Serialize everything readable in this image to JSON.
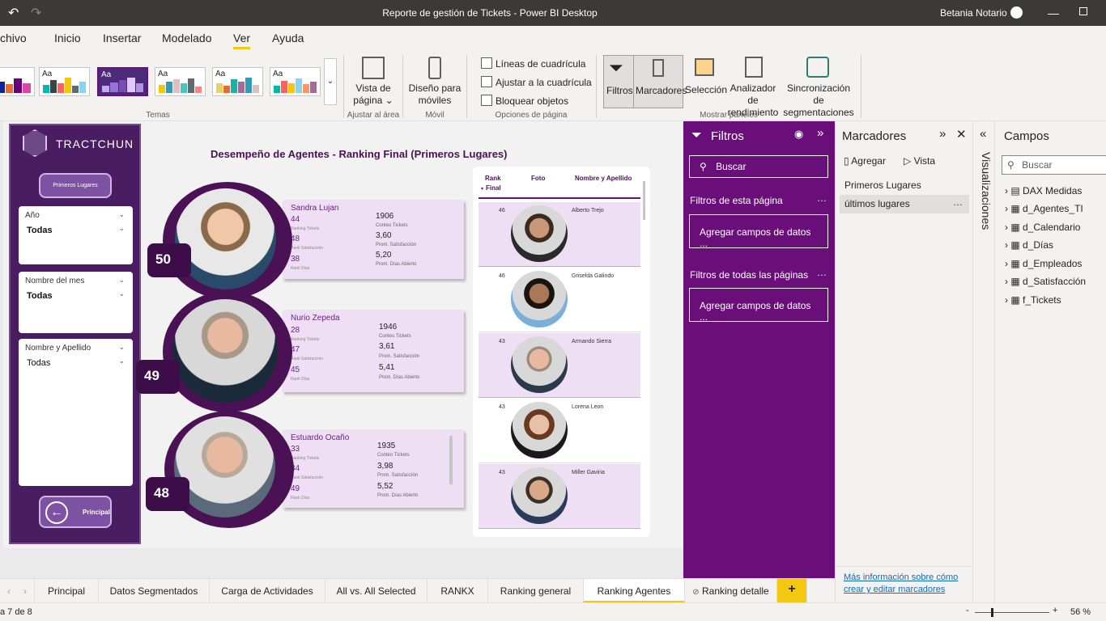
{
  "window": {
    "title": "Reporte de gestión de Tickets - Power BI Desktop",
    "user": "Betania Notario"
  },
  "menu": [
    "chivo",
    "Inicio",
    "Insertar",
    "Modelado",
    "Ver",
    "Ayuda"
  ],
  "ribbon": {
    "theme_aa": "Aa",
    "temas_label": "Temas",
    "vista_pagina": "Vista de",
    "vista_pagina2": "página",
    "ajustar_area": "Ajustar al área",
    "diseno_moviles": "Diseño para",
    "diseno_moviles2": "móviles",
    "movil": "Móvil",
    "lineas": "Líneas de cuadrícula",
    "ajustar": "Ajustar a la cuadrícula",
    "bloquear": "Bloquear objetos",
    "opciones": "Opciones de página",
    "filtros": "Filtros",
    "marcadores": "Marcadores",
    "seleccion": "Selección",
    "analizador": "Analizador de",
    "analizador2": "rendimiento",
    "sincronizacion": "Sincronización de",
    "sincronizacion2": "segmentaciones",
    "mostrar": "Mostrar paneles"
  },
  "report": {
    "brand": "TRACTCHUN",
    "btn_primeros": "Primeros Lugares",
    "btn_principal": "Principal",
    "title": "Desempeño de Agentes - Ranking Final (Primeros Lugares)",
    "slicers": [
      {
        "label": "Año",
        "value": "Todas"
      },
      {
        "label": "Nombre del mes",
        "value": "Todas"
      },
      {
        "label": "Nombre y Apellido",
        "value": "Todas"
      }
    ],
    "agents": [
      {
        "rank": "50",
        "name": "Sandra Lujan",
        "rt": "44",
        "rt_l": "Ranking Tickets",
        "rs": "48",
        "rs_l": "Rank Satisfacción",
        "rd": "38",
        "rd_l": "Rank Días",
        "ct": "1906",
        "ct_l": "Conteo Tickets",
        "ps": "3,60",
        "ps_l": "Prom. Satisfacción",
        "pd": "5,20",
        "pd_l": "Prom. Días Abierto"
      },
      {
        "rank": "49",
        "name": "Nurio Zepeda",
        "rt": "28",
        "rt_l": "Ranking Tickets",
        "rs": "47",
        "rs_l": "Rank Satisfacción",
        "rd": "45",
        "rd_l": "Rank Días",
        "ct": "1946",
        "ct_l": "Conteo Tickets",
        "ps": "3,61",
        "ps_l": "Prom. Satisfacción",
        "pd": "5,41",
        "pd_l": "Prom. Días Abierto"
      },
      {
        "rank": "48",
        "name": "Estuardo Ocaño",
        "rt": "33",
        "rt_l": "Ranking Tickets",
        "rs": "34",
        "rs_l": "Rank Satisfacción",
        "rd": "49",
        "rd_l": "Rank Días",
        "ct": "1935",
        "ct_l": "Conteo Tickets",
        "ps": "3,98",
        "ps_l": "Prom. Satisfacción",
        "pd": "5,52",
        "pd_l": "Prom. Días Abierto"
      }
    ],
    "table": {
      "headers": {
        "rank": "Rank",
        "rank2": "Final",
        "foto": "Foto",
        "nombre": "Nombre y Apellido"
      },
      "rows": [
        {
          "rank": "46",
          "name": "Alberto Trejo"
        },
        {
          "rank": "46",
          "name": "Griselda Galindo"
        },
        {
          "rank": "43",
          "name": "Armando Sierra"
        },
        {
          "rank": "43",
          "name": "Lorena Leon"
        },
        {
          "rank": "43",
          "name": "Miller Gaviria"
        }
      ]
    }
  },
  "filters": {
    "title": "Filtros",
    "search": "Buscar",
    "page_filters": "Filtros de esta página",
    "add_fields": "Agregar campos de datos ...",
    "all_filters": "Filtros de todas las páginas",
    "add_fields2": "Agregar campos de datos ..."
  },
  "bookmarks": {
    "title": "Marcadores",
    "add": "Agregar",
    "view": "Vista",
    "items": [
      "Primeros Lugares",
      "últimos lugares"
    ],
    "link1": "Más información sobre cómo",
    "link2": "crear y editar marcadores"
  },
  "viz": {
    "label": "Visualizaciones"
  },
  "fields": {
    "title": "Campos",
    "search": "Buscar",
    "items": [
      "DAX Medidas",
      "d_Agentes_TI",
      "d_Calendario",
      "d_Días",
      "d_Empleados",
      "d_Satisfacción",
      "f_Tickets"
    ]
  },
  "tabs": [
    "Principal",
    "Datos Segmentados",
    "Carga de Actividades",
    "All vs. All Selected",
    "RANKX",
    "Ranking general",
    "Ranking Agentes",
    "Ranking detalle"
  ],
  "status": {
    "page": "a 7 de 8",
    "zoom": "56 %"
  },
  "colors": {
    "accent": "#6a0f7a",
    "brand_dark": "#4a1d62",
    "card": "#efdff5",
    "tab_active": "#f2c811"
  }
}
